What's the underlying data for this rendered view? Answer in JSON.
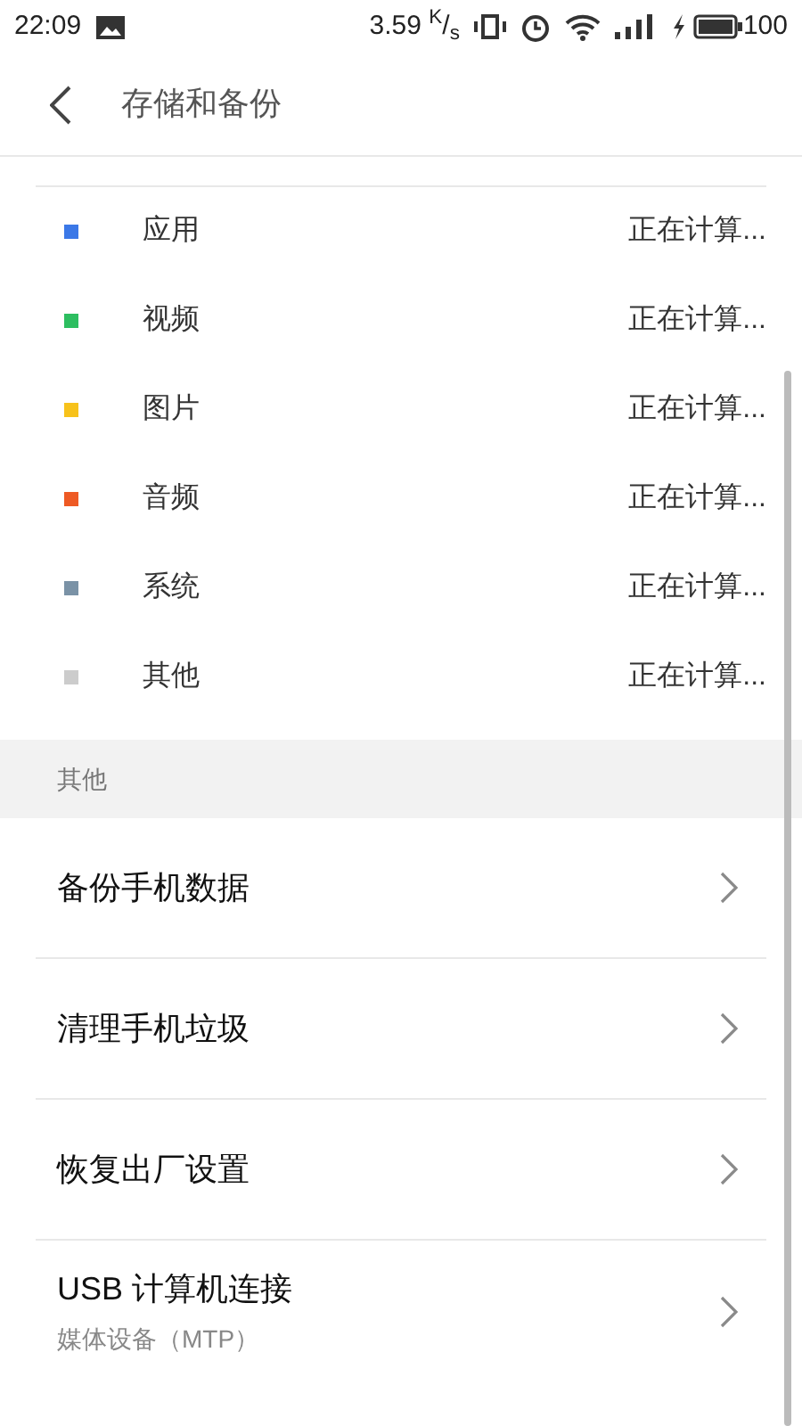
{
  "status_bar": {
    "time": "22:09",
    "speed": "3.59 $^{K}$/$_{s}$",
    "battery": "100"
  },
  "header": {
    "title": "存储和备份"
  },
  "storage_items": [
    {
      "label": "应用",
      "value": "正在计算...",
      "color": "#3b78e7"
    },
    {
      "label": "视频",
      "value": "正在计算...",
      "color": "#2dbe60"
    },
    {
      "label": "图片",
      "value": "正在计算...",
      "color": "#f7c21b"
    },
    {
      "label": "音频",
      "value": "正在计算...",
      "color": "#ee5a24"
    },
    {
      "label": "系统",
      "value": "正在计算...",
      "color": "#7a92a6"
    },
    {
      "label": "其他",
      "value": "正在计算...",
      "color": "#cccccc"
    }
  ],
  "section": {
    "title": "其他"
  },
  "menu_items": [
    {
      "title": "备份手机数据"
    },
    {
      "title": "清理手机垃圾"
    },
    {
      "title": "恢复出厂设置"
    },
    {
      "title": "USB 计算机连接",
      "subtitle": "媒体设备（MTP）"
    }
  ]
}
